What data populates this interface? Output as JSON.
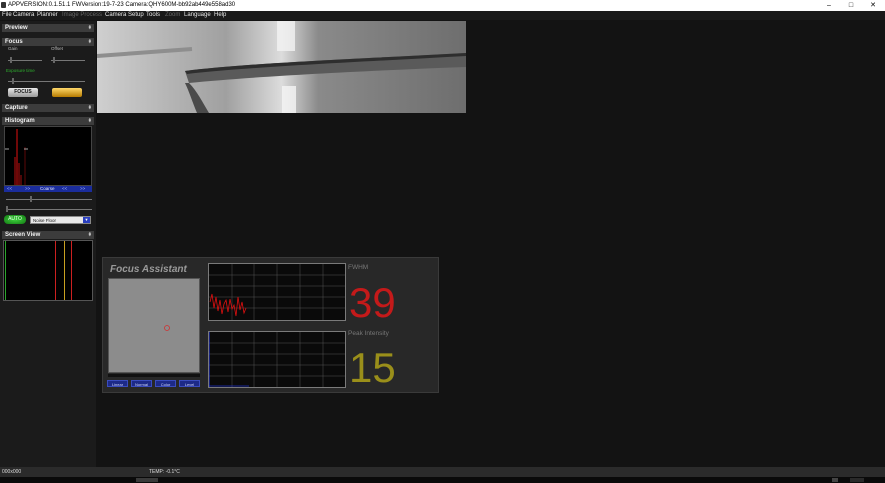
{
  "window": {
    "title": "APPVERSION:0.1.51.1   FWVersion:19-7-23   Camera:QHY600M-bb92ab449e558ad30",
    "controls": [
      "–",
      "□",
      "✕"
    ]
  },
  "menu": {
    "items": [
      {
        "label": "File",
        "enabled": true
      },
      {
        "label": "Camera",
        "enabled": true
      },
      {
        "label": "Planner",
        "enabled": true
      },
      {
        "label": "Image Process",
        "enabled": false
      },
      {
        "label": "Camera Setup",
        "enabled": true
      },
      {
        "label": "Tools",
        "enabled": true
      },
      {
        "label": "Zoom",
        "enabled": false
      },
      {
        "label": "Language",
        "enabled": true
      },
      {
        "label": "Help",
        "enabled": true
      }
    ]
  },
  "sidebar": {
    "preview": {
      "title": "Preview"
    },
    "focus": {
      "title": "Focus",
      "gain_label": "Gain",
      "offset_label": "Offset",
      "exposure_label": "Exposure time",
      "focus_button": "FOCUS",
      "capture_button": "",
      "gain_level": 0.05,
      "offset_level": 0.05,
      "exposure_level": 0.05
    },
    "capture": {
      "title": "Capture"
    },
    "histogram": {
      "title": "Histogram",
      "nav_labels": [
        "<<",
        ">>",
        "Coarse",
        "<<",
        ">>"
      ],
      "stretch_level": 0.28,
      "auto_button": "AUTO",
      "noise_select": "Noise Floor"
    },
    "screen_view": {
      "title": "Screen View"
    }
  },
  "focus_assistant": {
    "title": "Focus Assistant",
    "buttons": [
      "Linear",
      "Normal",
      "Color",
      "Level"
    ],
    "fwhm_label": "FWHM",
    "fwhm_value": "39",
    "peak_label": "Peak Intensity",
    "peak_value": "15",
    "colors": {
      "fwhm": "#c41a1a",
      "peak": "#9a8f1a",
      "fwhm_trace": "#e01010",
      "peak_trace": "#2233cc"
    }
  },
  "status": {
    "resolution": "000x000",
    "temperature": "TEMP: -0.1°C"
  }
}
